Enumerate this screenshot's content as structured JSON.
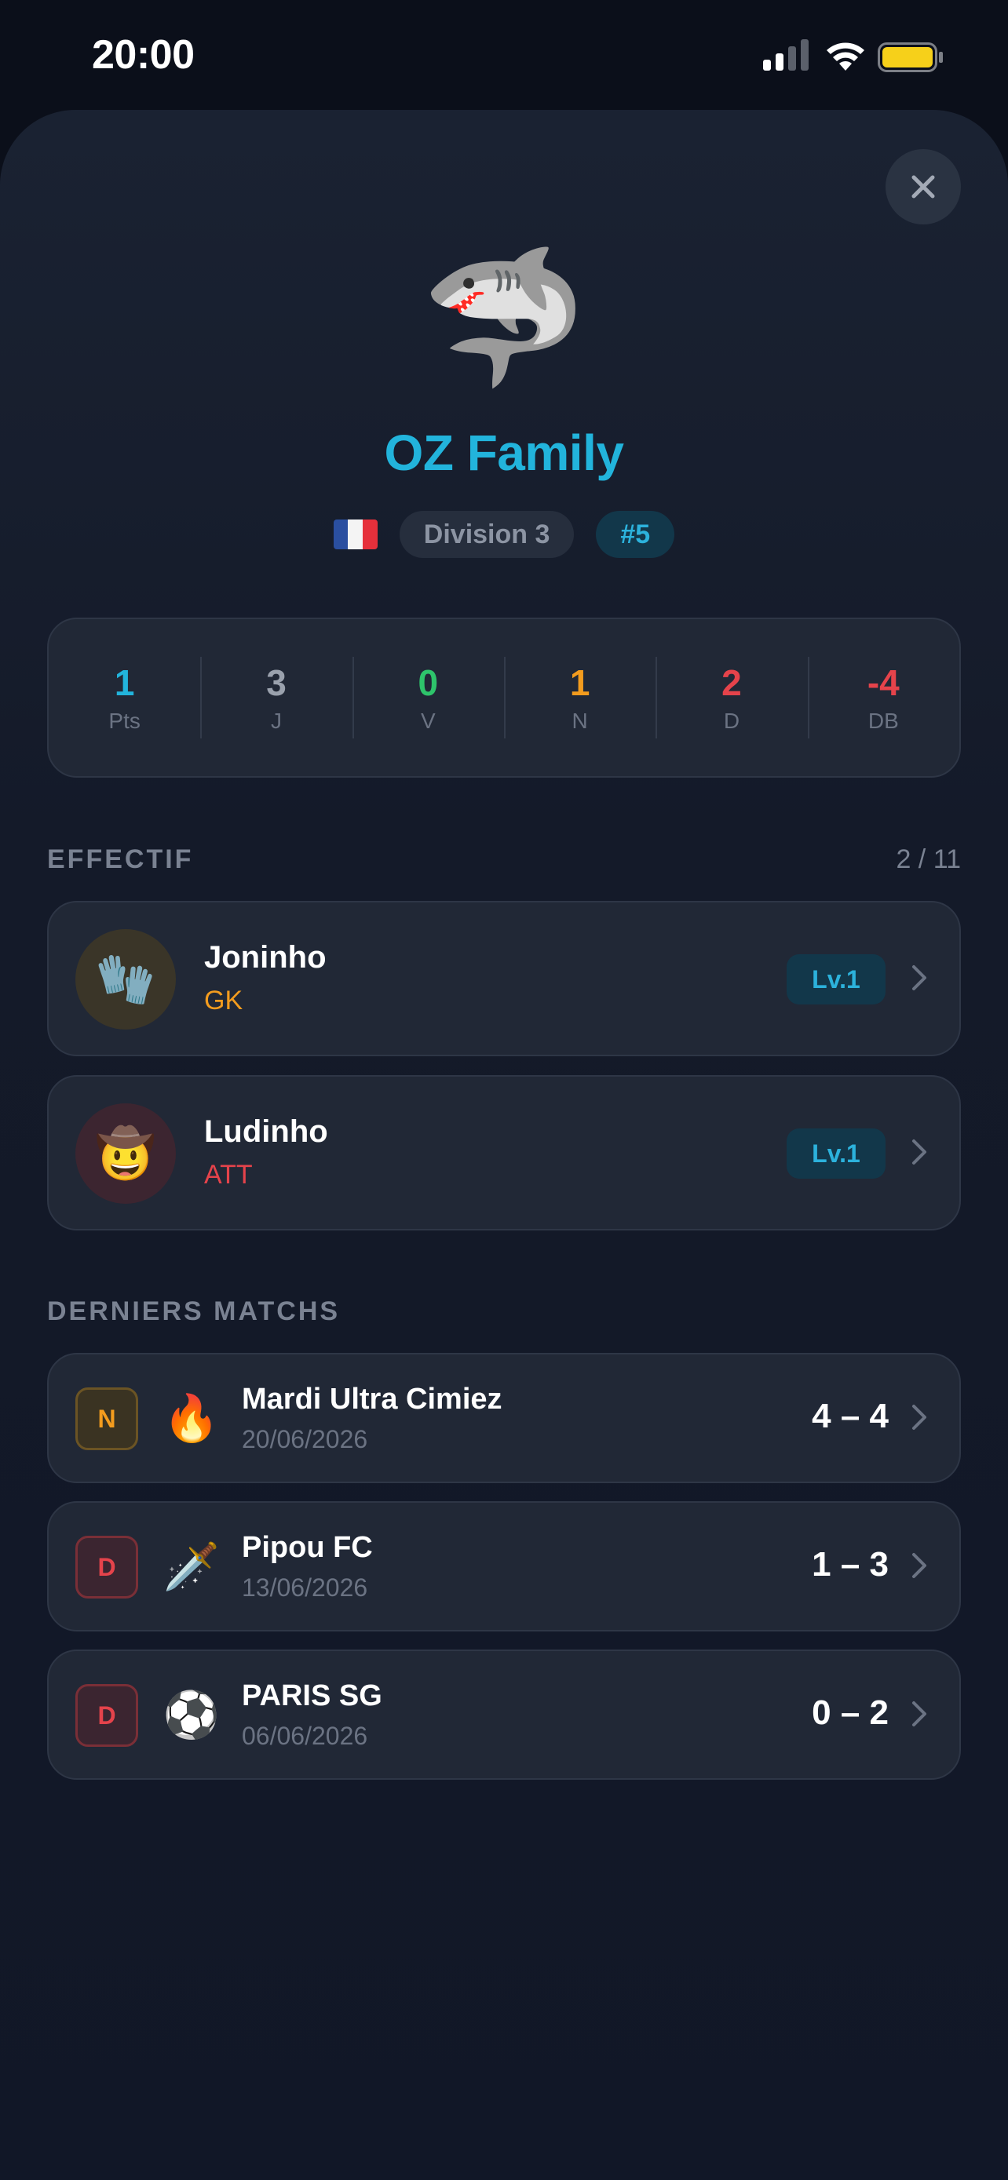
{
  "status_bar": {
    "time": "20:00"
  },
  "team": {
    "emoji": "🦈",
    "name": "OZ Family",
    "flag_colors": [
      "#2a4fa0",
      "#f4f4f4",
      "#e6303b"
    ],
    "division": "Division 3",
    "rank": "#5"
  },
  "stats": [
    {
      "value": "1",
      "label": "Pts",
      "color": "#22b4dc"
    },
    {
      "value": "3",
      "label": "J",
      "color": "#9aa1ad"
    },
    {
      "value": "0",
      "label": "V",
      "color": "#2ec46b"
    },
    {
      "value": "1",
      "label": "N",
      "color": "#f39c1e"
    },
    {
      "value": "2",
      "label": "D",
      "color": "#e5434b"
    },
    {
      "value": "-4",
      "label": "DB",
      "color": "#e5434b"
    }
  ],
  "effectif": {
    "title": "EFFECTIF",
    "count": "2 / 11",
    "players": [
      {
        "name": "Joninho",
        "position": "GK",
        "position_color": "#f39c1e",
        "avatar": "🧤",
        "avatar_bg": "#3a3528",
        "level": "Lv.1"
      },
      {
        "name": "Ludinho",
        "position": "ATT",
        "position_color": "#e5434b",
        "avatar": "🤠",
        "avatar_bg": "#3c2530",
        "level": "Lv.1"
      }
    ]
  },
  "matches": {
    "title": "DERNIERS MATCHS",
    "items": [
      {
        "result": "N",
        "icon": "🔥",
        "opponent": "Mardi Ultra Cimiez",
        "date": "20/06/2026",
        "score": "4 – 4"
      },
      {
        "result": "D",
        "icon": "🗡️",
        "opponent": "Pipou FC",
        "date": "13/06/2026",
        "score": "1 – 3"
      },
      {
        "result": "D",
        "icon": "⚽",
        "opponent": "PARIS SG",
        "date": "06/06/2026",
        "score": "0 – 2"
      }
    ]
  }
}
